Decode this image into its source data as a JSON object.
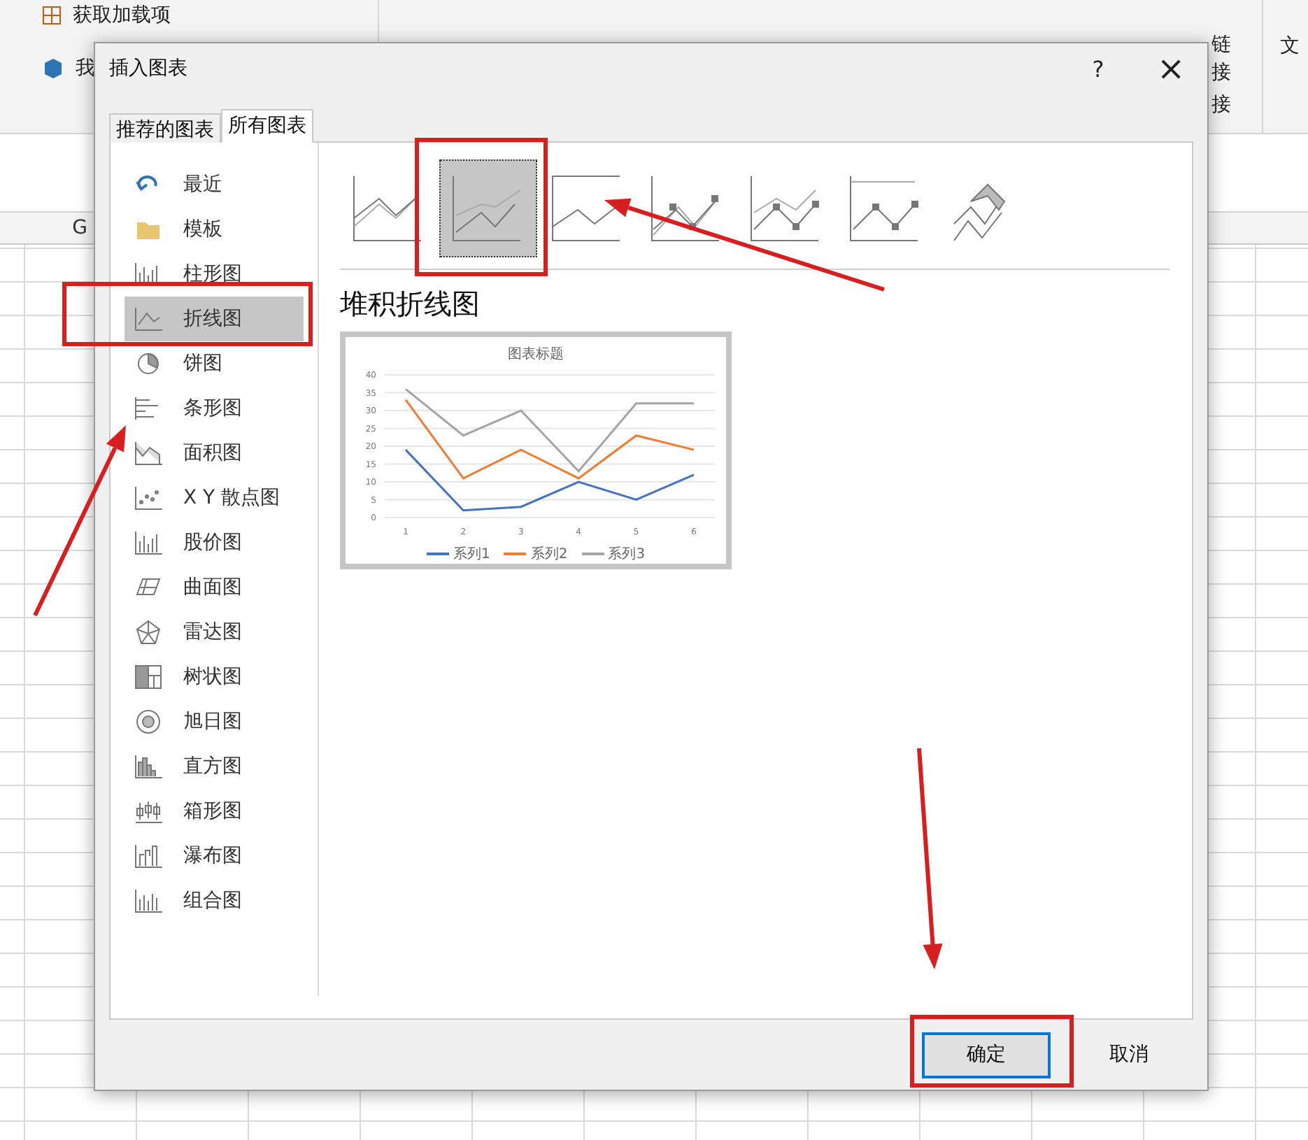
{
  "ribbon": {
    "left_items": [
      "获取加载项",
      "我"
    ],
    "right_items": [
      "链",
      "接"
    ],
    "group_label": "接",
    "cut_item": "文"
  },
  "sheet": {
    "columns": [
      "G"
    ]
  },
  "dialog": {
    "title": "插入图表",
    "help": "?",
    "close": "×",
    "tabs": [
      {
        "label": "推荐的图表",
        "selected": false
      },
      {
        "label": "所有图表",
        "selected": true
      }
    ],
    "categories": [
      {
        "label": "最近",
        "selected": false
      },
      {
        "label": "模板",
        "selected": false
      },
      {
        "label": "柱形图",
        "selected": false
      },
      {
        "label": "折线图",
        "selected": true
      },
      {
        "label": "饼图",
        "selected": false
      },
      {
        "label": "条形图",
        "selected": false
      },
      {
        "label": "面积图",
        "selected": false
      },
      {
        "label": "X Y 散点图",
        "selected": false
      },
      {
        "label": "股价图",
        "selected": false
      },
      {
        "label": "曲面图",
        "selected": false
      },
      {
        "label": "雷达图",
        "selected": false
      },
      {
        "label": "树状图",
        "selected": false
      },
      {
        "label": "旭日图",
        "selected": false
      },
      {
        "label": "直方图",
        "selected": false
      },
      {
        "label": "箱形图",
        "selected": false
      },
      {
        "label": "瀑布图",
        "selected": false
      },
      {
        "label": "组合图",
        "selected": false
      }
    ],
    "subtypes": [
      {
        "selected": false
      },
      {
        "selected": true
      },
      {
        "selected": false
      },
      {
        "selected": false
      },
      {
        "selected": false
      },
      {
        "selected": false
      },
      {
        "selected": false
      }
    ],
    "subtype_title": "堆积折线图",
    "preview": {
      "chart_data": {
        "type": "line",
        "title": "图表标题",
        "grid": true,
        "legend": "bottom",
        "categories": [
          "1",
          "2",
          "3",
          "4",
          "5",
          "6"
        ],
        "ylim": [
          0,
          40
        ],
        "yticks": [
          0,
          5,
          10,
          15,
          20,
          25,
          30,
          35,
          40
        ],
        "series": [
          {
            "name": "系列1",
            "color": "#4472c4",
            "values": [
              19,
              2,
              3,
              10,
              5,
              12
            ]
          },
          {
            "name": "系列2",
            "color": "#ed7d31",
            "values": [
              33,
              11,
              19,
              11,
              23,
              19
            ]
          },
          {
            "name": "系列3",
            "color": "#a5a5a5",
            "values": [
              36,
              23,
              30,
              13,
              32,
              32
            ]
          }
        ]
      }
    },
    "buttons": [
      {
        "label": "确定",
        "default": true
      },
      {
        "label": "取消",
        "default": false
      }
    ]
  },
  "annotations": [
    {
      "kind": "frame"
    },
    {
      "kind": "frame"
    },
    {
      "kind": "frame"
    },
    {
      "kind": "arrow"
    },
    {
      "kind": "arrow"
    },
    {
      "kind": "arrow"
    }
  ]
}
